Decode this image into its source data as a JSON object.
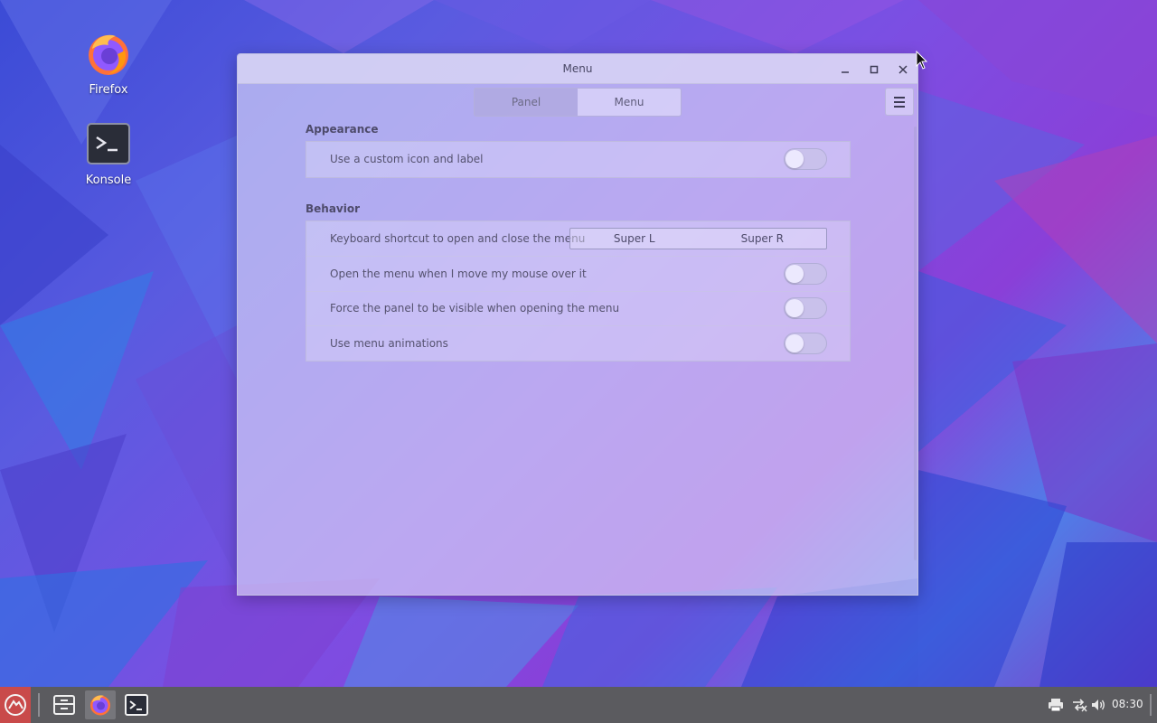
{
  "desktop": {
    "icons": [
      {
        "label": "Firefox",
        "icon": "firefox-icon"
      },
      {
        "label": "Konsole",
        "icon": "terminal-icon"
      }
    ]
  },
  "window": {
    "title": "Menu",
    "controls": {
      "minimize": "minimize-icon",
      "maximize": "maximize-icon",
      "close": "close-icon"
    },
    "tabs": [
      {
        "label": "Panel",
        "active": false
      },
      {
        "label": "Menu",
        "active": true
      }
    ],
    "menu_icon": "hamburger-icon",
    "sections": {
      "appearance": {
        "title": "Appearance",
        "rows": [
          {
            "label": "Use a custom icon and label",
            "toggle": false
          }
        ]
      },
      "behavior": {
        "title": "Behavior",
        "shortcut_row": {
          "label": "Keyboard shortcut to open and close the menu",
          "keys": [
            "Super L",
            "Super R"
          ]
        },
        "rows": [
          {
            "label": "Open the menu when I move my mouse over it",
            "toggle": false
          },
          {
            "label": "Force the panel to be visible when opening the menu",
            "toggle": false
          },
          {
            "label": "Use menu animations",
            "toggle": false
          }
        ]
      }
    }
  },
  "taskbar": {
    "start_icon": "start-menu-icon",
    "apps": [
      {
        "name": "file-manager",
        "icon": "file-manager-icon",
        "active": false
      },
      {
        "name": "firefox",
        "icon": "firefox-icon",
        "active": true
      },
      {
        "name": "konsole",
        "icon": "terminal-icon",
        "active": false
      }
    ],
    "tray": [
      "printer-icon",
      "network-icon",
      "volume-icon"
    ],
    "clock": "08:30"
  },
  "colors": {
    "taskbar": "#5b5b5f",
    "start_button": "#c94a4a",
    "window_tint": "#e2defa"
  }
}
